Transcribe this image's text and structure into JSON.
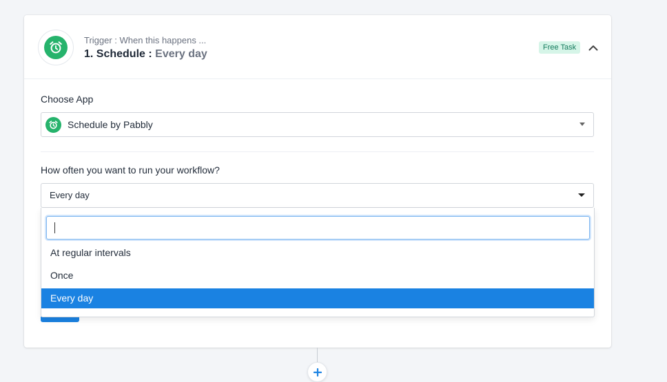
{
  "header": {
    "trigger_caption": "Trigger : When this happens ...",
    "step_title": "1. Schedule :",
    "step_subtitle": "Every day",
    "badge": "Free Task",
    "app_icon": "alarm-clock-icon",
    "collapse_icon": "chevron-up-icon"
  },
  "choose_app": {
    "label": "Choose App",
    "selected_app": "Schedule by Pabbly",
    "icon": "alarm-clock-icon"
  },
  "frequency": {
    "label": "How often you want to run your workflow?",
    "selected": "Every day",
    "search_value": "",
    "options": [
      "At regular intervals",
      "Once",
      "Every day"
    ]
  },
  "add_step_icon": "plus-icon",
  "colors": {
    "brand_green": "#26b36c",
    "selection_blue": "#1a82e2",
    "badge_bg": "#d6f5e8",
    "badge_text": "#13795b"
  }
}
